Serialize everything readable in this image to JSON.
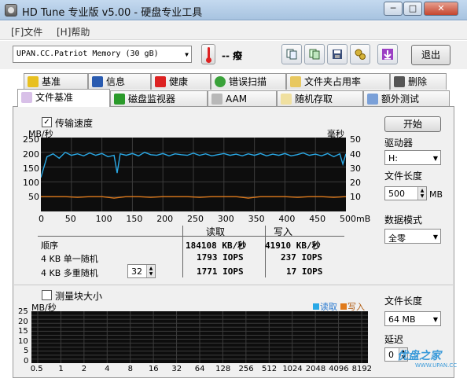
{
  "window": {
    "title": "HD Tune 专业版 v5.00 - 硬盘专业工具",
    "min": "─",
    "max": "□",
    "close": "✕"
  },
  "menu": [
    "[F]文件",
    "[H]帮助"
  ],
  "toolbar": {
    "drive": "UPAN.CC.Patriot Memory  (30 gB)",
    "temperature": "-- 癈",
    "exit_label": "退出"
  },
  "tabs_top": [
    "基准",
    "信息",
    "健康",
    "错误扫描",
    "文件夹占用率",
    "删除"
  ],
  "tabs_bottom": [
    "文件基准",
    "磁盘监视器",
    "AAM",
    "随机存取",
    "额外测试"
  ],
  "transfer": {
    "checkbox_label": "传输速度",
    "checked_mark": "✓",
    "y_left_unit": "MB/秒",
    "y_right_unit": "毫秒",
    "y_left_ticks": [
      "250",
      "200",
      "150",
      "100",
      "50"
    ],
    "y_right_ticks": [
      "50",
      "40",
      "30",
      "20",
      "10"
    ],
    "x_ticks": [
      "0",
      "50",
      "100",
      "150",
      "200",
      "250",
      "300",
      "350",
      "400",
      "450",
      "500mB"
    ]
  },
  "results": {
    "col_read": "读取",
    "col_write": "写入",
    "rows": [
      {
        "label": "顺序",
        "read": "184108 KB/秒",
        "write": "41910 KB/秒"
      },
      {
        "label": "4 KB 单一随机",
        "read": "1793 IOPS",
        "write": "237 IOPS"
      },
      {
        "label": "4 KB 多重随机",
        "read": "1771 IOPS",
        "write": "17 IOPS"
      }
    ],
    "queue_depth": "32"
  },
  "side": {
    "start_label": "开始",
    "drive_label": "驱动器",
    "drive_value": "H:",
    "file_length_label": "文件长度",
    "file_length_value": "500",
    "file_length_unit": "MB",
    "data_mode_label": "数据模式",
    "data_mode_value": "全零"
  },
  "block": {
    "checkbox_label": "测量块大小",
    "y_unit": "MB/秒",
    "legend_read": "读取",
    "legend_write": "写入",
    "y_ticks": [
      "25",
      "20",
      "15",
      "10",
      "5",
      "0"
    ],
    "x_ticks": [
      "0.5",
      "1",
      "2",
      "4",
      "8",
      "16",
      "32",
      "64",
      "128",
      "256",
      "512",
      "1024",
      "2048",
      "4096",
      "8192"
    ],
    "file_length_label": "文件长度",
    "file_length_value": "64 MB",
    "delay_label": "延迟",
    "delay_value": "0"
  },
  "watermark": {
    "main": "优盘之家",
    "sub": "WWW.UPAN.CC"
  },
  "colors": {
    "read": "#2aa9e6",
    "write": "#e07a1a",
    "graph_bg": "#0d0d0d",
    "grid": "#3c3c3c"
  },
  "chart_data": {
    "type": "line",
    "title": "",
    "xlabel": "",
    "ylabel": "MB/秒",
    "xlim": [
      0,
      500
    ],
    "ylim": [
      0,
      250
    ],
    "y2lim": [
      0,
      50
    ],
    "grid": true,
    "series": [
      {
        "name": "",
        "axis": "left",
        "x": [
          0,
          10,
          20,
          30,
          40,
          50,
          60,
          70,
          80,
          90,
          100,
          110,
          120,
          125,
          130,
          140,
          150,
          160,
          170,
          180,
          190,
          200,
          210,
          220,
          230,
          240,
          250,
          260,
          270,
          280,
          290,
          300,
          310,
          320,
          330,
          340,
          350,
          360,
          370,
          380,
          390,
          400,
          410,
          420,
          430,
          440,
          450,
          460,
          470,
          480,
          490,
          495,
          500
        ],
        "y": [
          115,
          185,
          195,
          180,
          200,
          190,
          195,
          188,
          198,
          190,
          196,
          185,
          190,
          130,
          195,
          190,
          196,
          188,
          200,
          192,
          190,
          196,
          188,
          195,
          192,
          190,
          197,
          190,
          195,
          188,
          192,
          196,
          190,
          194,
          188,
          195,
          190,
          196,
          188,
          194,
          190,
          196,
          188,
          192,
          198,
          190,
          194,
          188,
          196,
          185,
          195,
          160,
          195
        ]
      },
      {
        "name": "",
        "axis": "right",
        "x": [
          0,
          20,
          40,
          60,
          80,
          100,
          120,
          140,
          160,
          180,
          200,
          220,
          240,
          260,
          280,
          300,
          320,
          340,
          360,
          380,
          400,
          420,
          440,
          460,
          480,
          500
        ],
        "y": [
          10,
          10,
          10,
          9.5,
          10,
          10,
          9,
          10,
          10,
          9.5,
          10,
          10,
          10,
          9.5,
          10,
          10,
          10,
          9,
          10,
          10,
          10,
          9.5,
          10,
          10,
          9.5,
          10
        ]
      }
    ]
  }
}
